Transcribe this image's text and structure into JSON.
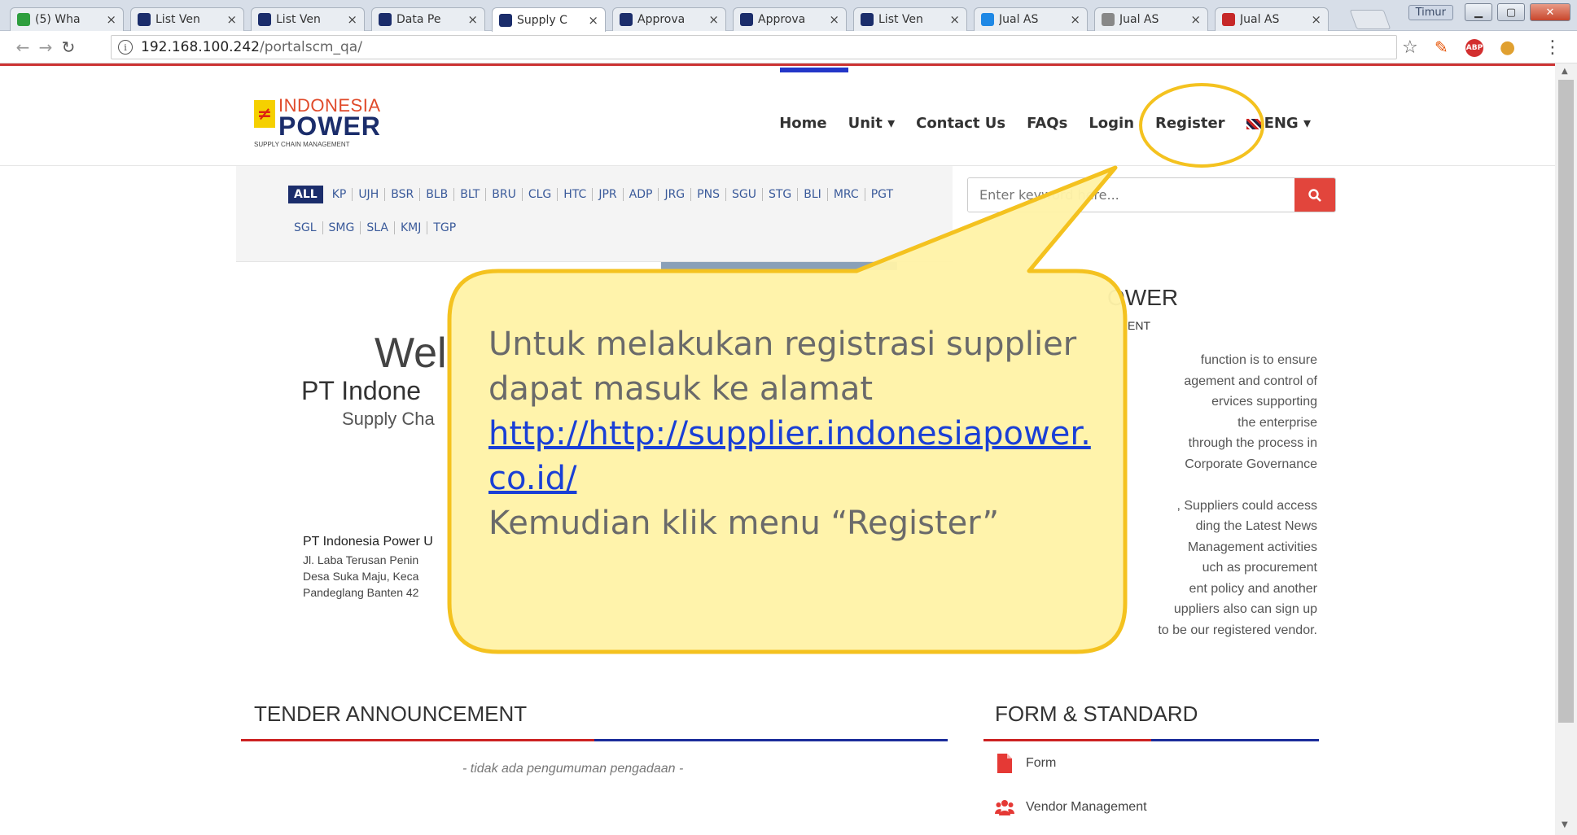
{
  "browser": {
    "tabs": [
      {
        "label": "(5) Wha",
        "icon": "whatsapp-icon",
        "color": "#2e9e3e"
      },
      {
        "label": "List Ven",
        "icon": "page-icon",
        "color": "#1b2d6b"
      },
      {
        "label": "List Ven",
        "icon": "page-icon",
        "color": "#1b2d6b"
      },
      {
        "label": "Data Pe",
        "icon": "page-icon",
        "color": "#1b2d6b"
      },
      {
        "label": "Supply C",
        "icon": "page-icon",
        "color": "#1b2d6b"
      },
      {
        "label": "Approva",
        "icon": "page-icon",
        "color": "#1b2d6b"
      },
      {
        "label": "Approva",
        "icon": "page-icon",
        "color": "#1b2d6b"
      },
      {
        "label": "List Ven",
        "icon": "page-icon",
        "color": "#1b2d6b"
      },
      {
        "label": "Jual AS",
        "icon": "wave-icon",
        "color": "#1e88e5"
      },
      {
        "label": "Jual AS",
        "icon": "dot-icon",
        "color": "#888"
      },
      {
        "label": "Jual AS",
        "icon": "shop-icon",
        "color": "#c62828"
      }
    ],
    "active_tab": 4,
    "user_badge": "Timur",
    "url_host": "192.168.100.242",
    "url_path": "/portalscm_qa/"
  },
  "site": {
    "logo_line1": "INDONESIA",
    "logo_line2": "POWER",
    "logo_line3": "SUPPLY CHAIN MANAGEMENT",
    "nav": {
      "home": "Home",
      "unit": "Unit ▾",
      "contact": "Contact Us",
      "faqs": "FAQs",
      "login": "Login",
      "register": "Register",
      "lang": "ENG ▾"
    },
    "units_row1": [
      "ALL",
      "KP",
      "UJH",
      "BSR",
      "BLB",
      "BLT",
      "BRU",
      "CLG",
      "HTC",
      "JPR",
      "ADP",
      "JRG",
      "PNS",
      "SGU",
      "STG",
      "BLI",
      "MRC",
      "PGT"
    ],
    "units_row2": [
      "SGL",
      "SMG",
      "SLA",
      "KMJ",
      "TGP"
    ],
    "search_placeholder": "Enter keyword here...",
    "hero": {
      "welcome": "Wel",
      "company": "PT Indone",
      "subtitle": "Supply Cha",
      "address_title": "PT Indonesia Power U",
      "address_lines": [
        "Jl. Laba Terusan Penin",
        "Desa Suka Maju, Keca",
        "Pandeglang Banten 42"
      ]
    },
    "about": {
      "title": "OWER",
      "subtitle": "ENT",
      "body_lines": [
        "function is to ensure",
        "agement and control of",
        "ervices supporting",
        "the enterprise",
        "through the process in",
        "Corporate Governance",
        "",
        ", Suppliers could access",
        "ding the Latest News",
        "Management activities",
        "uch as procurement",
        "ent policy and another",
        "uppliers also can sign up",
        "to be our registered vendor."
      ]
    },
    "tender_title": "TENDER ANNOUNCEMENT",
    "tender_empty": "- tidak ada pengumuman pengadaan -",
    "form_title": "FORM & STANDARD",
    "form_items": [
      "Form",
      "Vendor Management"
    ]
  },
  "callout": {
    "line1": "Untuk melakukan registrasi supplier",
    "line2": "dapat masuk ke alamat",
    "link_line1": "http://http://supplier.indonesiapower.",
    "link_line2": "co.id/",
    "line3": "Kemudian klik menu “Register”"
  }
}
